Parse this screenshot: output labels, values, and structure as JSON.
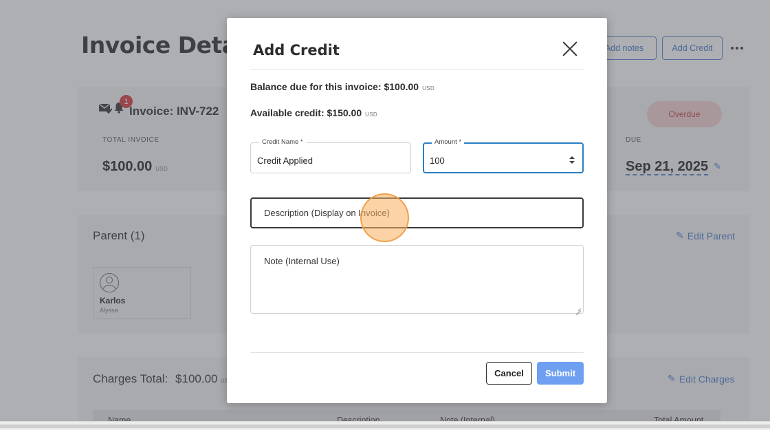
{
  "page": {
    "title": "Invoice Details",
    "add_notes_label": "Add notes",
    "add_credit_label": "Add Credit",
    "more_icon": "more-horizontal-icon"
  },
  "invoice_card": {
    "notification_count": "1",
    "invoice_title": "Invoice: INV-722",
    "total_invoice_label": "TOTAL INVOICE",
    "total_amount": "$100.00",
    "currency": "USD",
    "status": "Overdue",
    "due_label": "DUE",
    "due_date": "Sep 21, 2025"
  },
  "parent_section": {
    "title": "Parent (1)",
    "edit_label": "Edit Parent",
    "parent_name": "Karlos",
    "parent_sub": "Alyssa"
  },
  "charges_section": {
    "title": "Charges Total:",
    "amount": "$100.00",
    "currency": "US",
    "edit_label": "Edit Charges",
    "columns": [
      "Name",
      "Description",
      "Note (Internal)",
      "Total Amount"
    ]
  },
  "modal": {
    "title": "Add Credit",
    "balance_text": "Balance due for this invoice: $100.00",
    "balance_currency": "USD",
    "available_text": "Available credit: $150.00",
    "available_currency": "USD",
    "credit_name_label": "Credit Name *",
    "credit_name_value": "Credit Applied",
    "amount_label": "Amount *",
    "amount_value": "100",
    "description_placeholder": "Description (Display on Invoice)",
    "note_placeholder": "Note (Internal Use)",
    "cancel_label": "Cancel",
    "submit_label": "Submit"
  },
  "colors": {
    "accent": "#4d7fd0",
    "focus": "#2a7fc4",
    "submit": "#6e9ff0",
    "overdue_bg": "#f4d2d2",
    "overdue_text": "#c44343",
    "badge": "#d6373c"
  }
}
